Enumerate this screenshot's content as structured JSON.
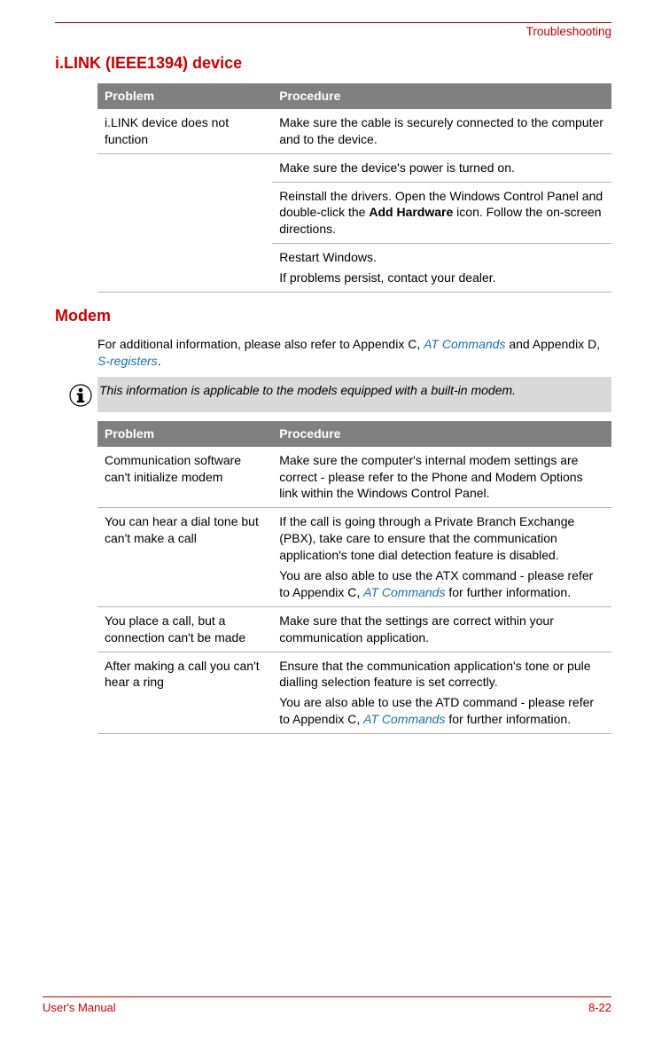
{
  "header": {
    "section": "Troubleshooting"
  },
  "section1": {
    "title": "i.LINK (IEEE1394) device",
    "colProblem": "Problem",
    "colProcedure": "Procedure",
    "rows": [
      {
        "problem": "i.LINK device does not function",
        "proc": "Make sure the cable is securely connected to the computer and to the device."
      },
      {
        "problem": "",
        "proc": "Make sure the device's power is turned on."
      },
      {
        "problem": "",
        "procPrefix": "Reinstall the drivers. Open the Windows Control Panel and double-click the ",
        "procBold": "Add Hardware",
        "procSuffix": " icon. Follow the on-screen directions."
      },
      {
        "problem": "",
        "procLine1": "Restart Windows.",
        "procLine2": "If problems persist, contact your dealer."
      }
    ]
  },
  "section2": {
    "title": "Modem",
    "introPrefix": "For additional information, please also refer to Appendix C, ",
    "introLink1": "AT Commands",
    "introMiddle": " and Appendix D, ",
    "introLink2": "S-registers",
    "introSuffix": ".",
    "note": "This information is applicable to the models equipped with a built-in modem.",
    "colProblem": "Problem",
    "colProcedure": "Procedure",
    "rows": [
      {
        "problem": "Communication software can't initialize modem",
        "proc": "Make sure the computer's internal modem settings are correct - please refer to the Phone and Modem Options link within the Windows Control Panel."
      },
      {
        "problem": "You can hear a dial tone but can't make a call",
        "procP1": "If the call is going through a Private Branch Exchange (PBX), take care to ensure that the communication application's tone dial detection feature is disabled.",
        "procP2a": "You are also able to use the ATX command - please refer to Appendix C, ",
        "procP2link": "AT Commands",
        "procP2b": " for further information."
      },
      {
        "problem": "You place a call, but a connection can't be made",
        "proc": "Make sure that the settings are correct within your communication application."
      },
      {
        "problem": "After making a call you can't hear a ring",
        "procP1": "Ensure that the communication application's tone or pule dialling selection feature is set correctly.",
        "procP2a": "You are also able to use the ATD command - please refer to Appendix C, ",
        "procP2link": "AT Commands",
        "procP2b": " for further information."
      }
    ]
  },
  "footer": {
    "left": "User's Manual",
    "right": "8-22"
  }
}
